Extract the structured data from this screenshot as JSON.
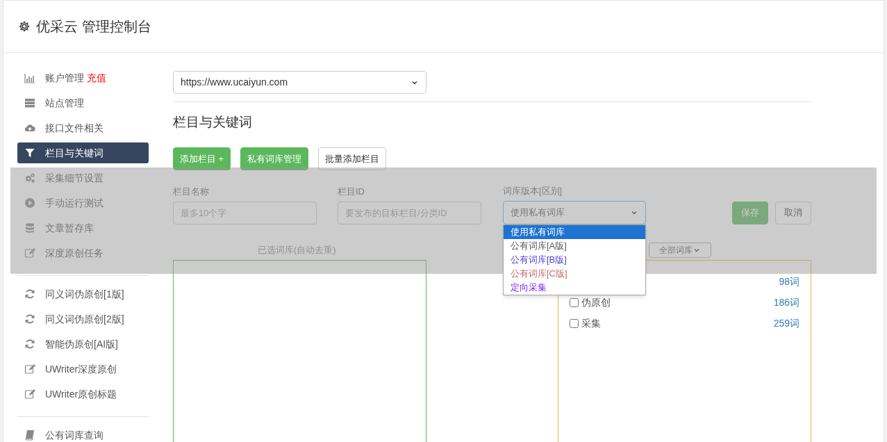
{
  "header": {
    "title": "优采云 管理控制台"
  },
  "sidebar": {
    "groups": [
      {
        "items": [
          {
            "label": "账户管理",
            "badge": "充值",
            "selected": false
          },
          {
            "label": "站点管理",
            "selected": false
          },
          {
            "label": "接口文件相关",
            "selected": false
          },
          {
            "label": "栏目与关键词",
            "selected": true
          },
          {
            "label": "采集细节设置",
            "selected": false
          },
          {
            "label": "手动运行测试",
            "selected": false
          },
          {
            "label": "文章暂存库",
            "selected": false
          },
          {
            "label": "深度原创任务",
            "selected": false
          }
        ]
      },
      {
        "items": [
          {
            "label": "同义词伪原创[1版]",
            "selected": false
          },
          {
            "label": "同义词伪原创[2版]",
            "selected": false
          },
          {
            "label": "智能伪原创[AI版]",
            "selected": false
          },
          {
            "label": "UWriter深度原创",
            "selected": false
          },
          {
            "label": "UWriter原创标题",
            "selected": false
          }
        ]
      },
      {
        "items": [
          {
            "label": "公有词库查询",
            "selected": false
          }
        ]
      }
    ]
  },
  "site_select": {
    "value": "https://www.ucaiyun.com"
  },
  "section_title": "栏目与关键词",
  "toolbar": [
    {
      "label": "添加栏目 +",
      "kind": "primary"
    },
    {
      "label": "私有词库管理",
      "kind": "primary"
    },
    {
      "label": "批量添加栏目",
      "kind": "default"
    }
  ],
  "form": {
    "fields": [
      {
        "label": "栏目名称",
        "placeholder": "最多10个字",
        "kind": "input"
      },
      {
        "label": "栏目ID",
        "placeholder": "要发布的目标栏目/分类ID",
        "kind": "input"
      },
      {
        "label": "词库版本[区别]",
        "value": "使用私有词库",
        "kind": "select",
        "expanded": true,
        "options": [
          {
            "label": "使用私有词库",
            "selected": true
          },
          {
            "label": "公有词库[A版]",
            "selected": false,
            "color": "#555555"
          },
          {
            "label": "公有词库[B版]",
            "selected": false,
            "color": "#4b3fd8"
          },
          {
            "label": "公有词库[C版]",
            "selected": false,
            "color": "#c46a6a"
          },
          {
            "label": "定向采集",
            "selected": false,
            "color": "#7a1fff"
          }
        ]
      }
    ],
    "buttons": [
      {
        "label": "保存",
        "kind": "primary"
      },
      {
        "label": "取消",
        "kind": "default"
      }
    ]
  },
  "selected_words": {
    "label": "已选词库(自动去重)"
  },
  "library": {
    "filter": "全部词库",
    "items": [
      {
        "count": "98词"
      },
      {
        "label": "伪原创",
        "checked": false,
        "count": "186词"
      },
      {
        "label": "采集",
        "checked": false,
        "count": "259词"
      }
    ]
  }
}
